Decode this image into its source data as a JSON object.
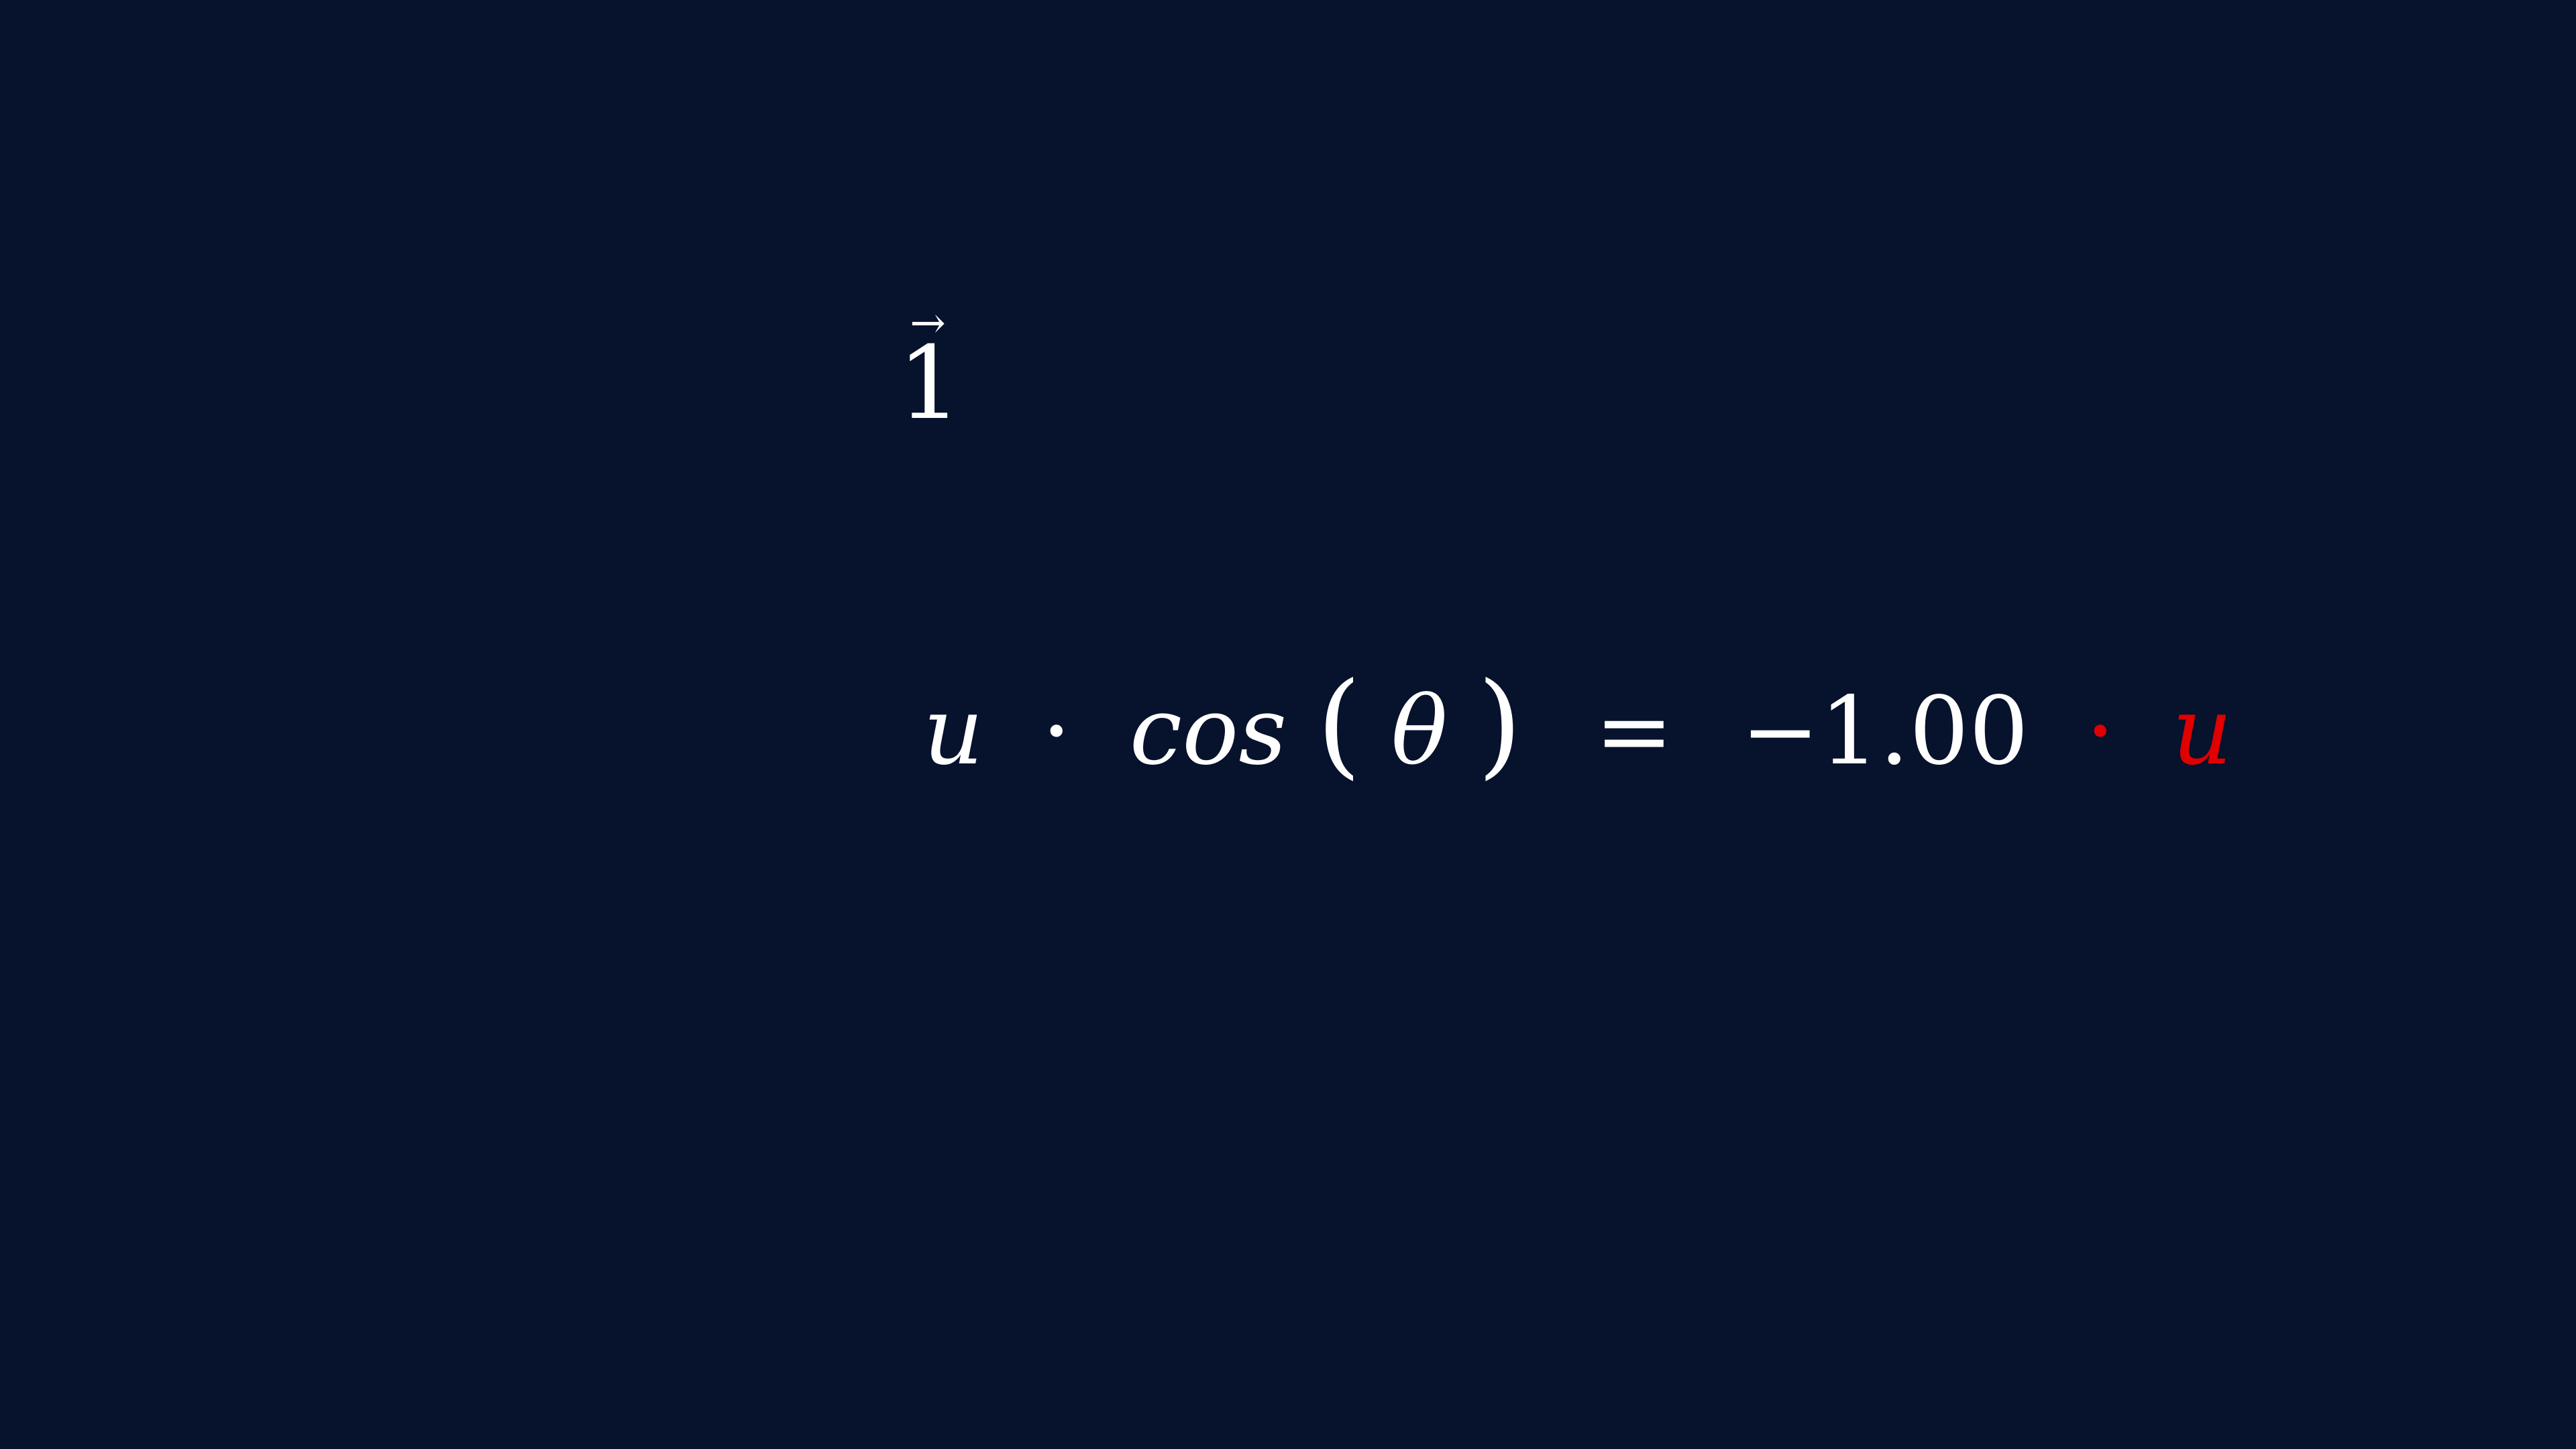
{
  "colors": {
    "background": "#07122c",
    "text": "#ffffff",
    "highlight": "#e00000"
  },
  "vector_label": {
    "arrow": "→",
    "value": "1"
  },
  "equation": {
    "u_left": "u",
    "dot_left": "·",
    "cos": "cos",
    "paren_open": "(",
    "theta": "θ",
    "paren_close": ")",
    "equals": "=",
    "value": "−1.00",
    "dot_right": "·",
    "u_right": "u"
  }
}
